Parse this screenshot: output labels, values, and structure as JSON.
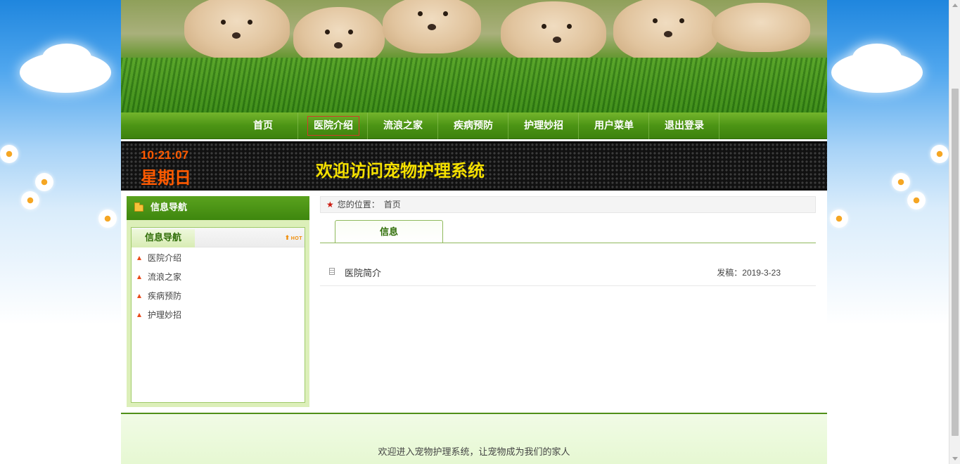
{
  "nav": {
    "items": [
      {
        "label": "首页"
      },
      {
        "label": "医院介绍"
      },
      {
        "label": "流浪之家"
      },
      {
        "label": "疾病预防"
      },
      {
        "label": "护理妙招"
      },
      {
        "label": "用户菜单"
      },
      {
        "label": "退出登录"
      }
    ],
    "active_index": 1
  },
  "header": {
    "clock": "10:21:07",
    "weekday": "星期日",
    "welcome": "欢迎访问宠物护理系统"
  },
  "sidebar": {
    "title": "信息导航",
    "box_tab": "信息导航",
    "hot_badge": "HOT",
    "links": [
      {
        "label": "医院介绍"
      },
      {
        "label": "流浪之家"
      },
      {
        "label": "疾病预防"
      },
      {
        "label": "护理妙招"
      }
    ]
  },
  "breadcrumb": {
    "prefix": "您的位置：",
    "current": "首页"
  },
  "content": {
    "tab_label": "信息",
    "articles": [
      {
        "title": "医院简介",
        "date_label": "发稿：",
        "date": "2019-3-23"
      }
    ]
  },
  "footer": {
    "text": "欢迎进入宠物护理系统，让宠物成为我们的家人"
  },
  "colors": {
    "nav_green": "#4c9415",
    "clock_orange": "#ff5a00",
    "welcome_yellow": "#f5e000",
    "star_red": "#cc1a10"
  },
  "icons": [
    "folder-icon",
    "hot-icon",
    "arrow-up-icon",
    "star-icon",
    "document-icon"
  ]
}
